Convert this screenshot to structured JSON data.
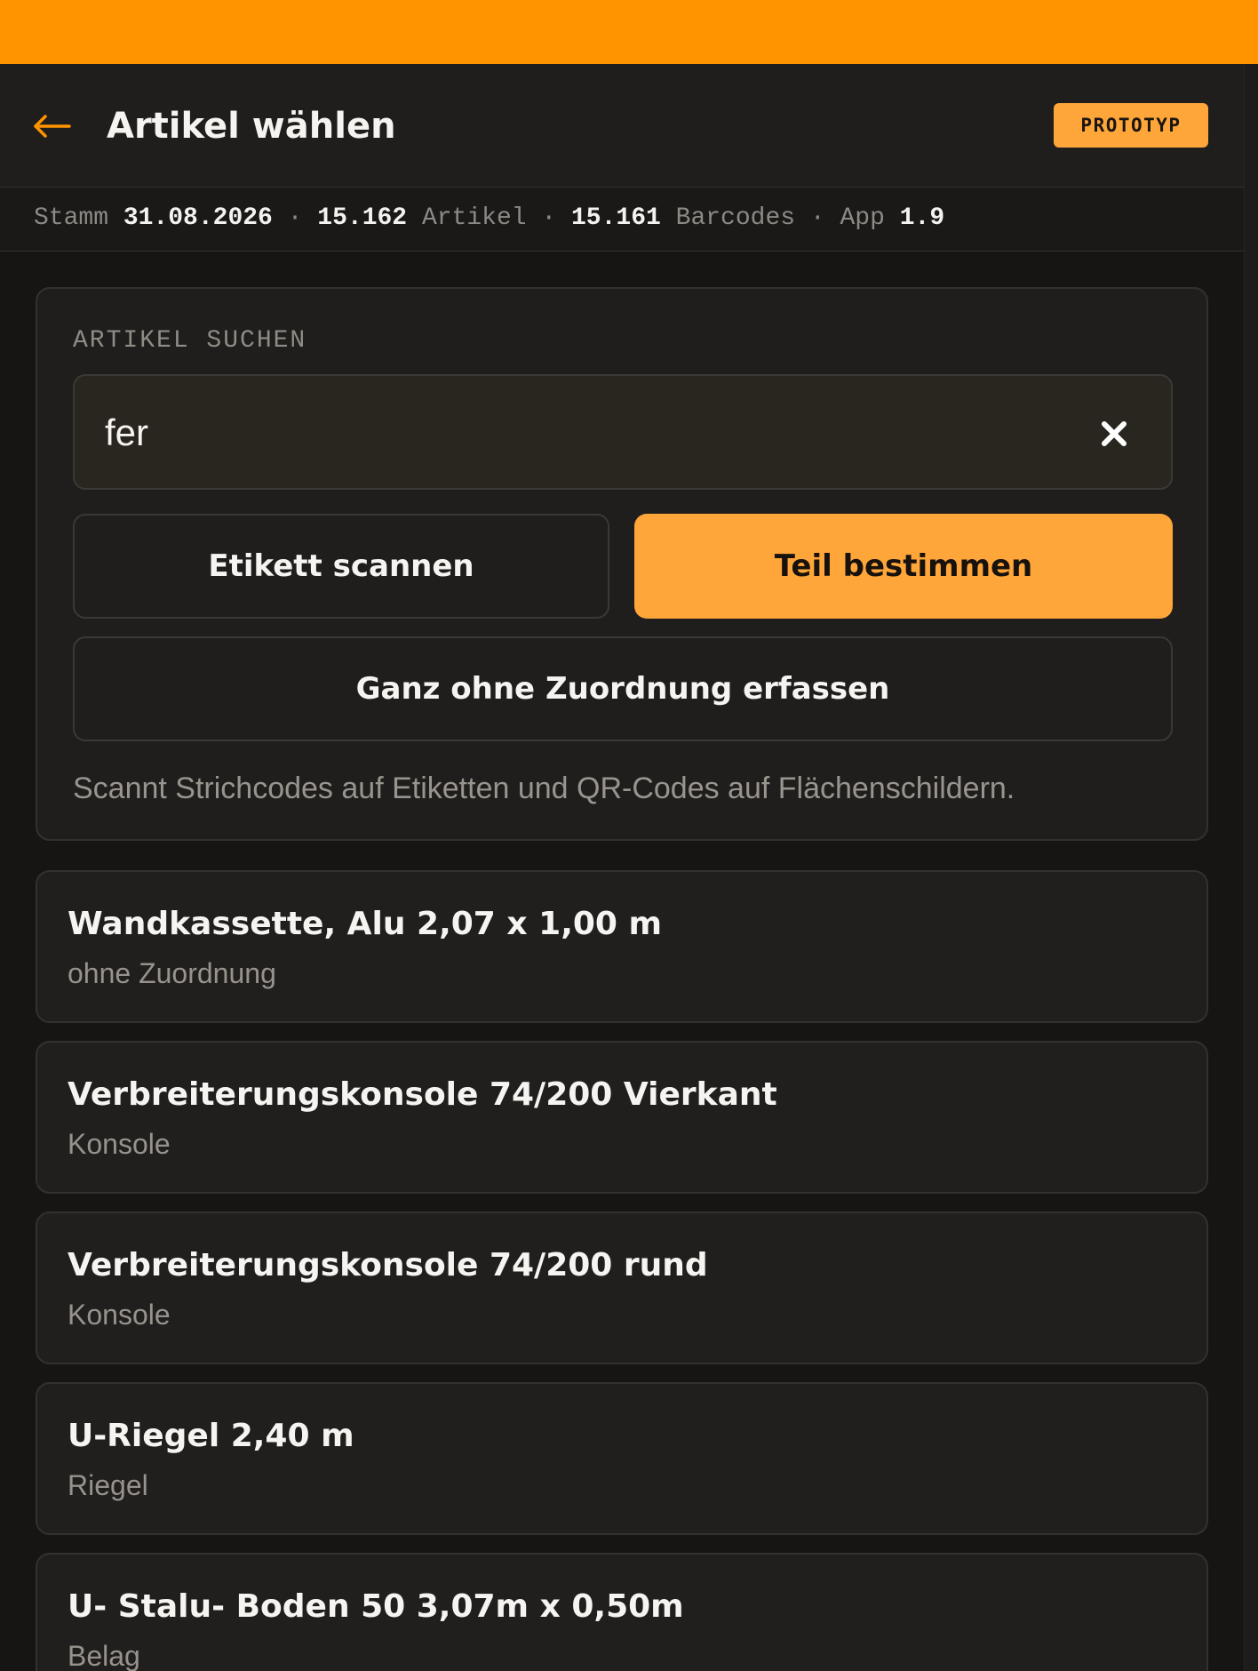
{
  "header": {
    "title": "Artikel wählen",
    "badge": "PROTOTYP"
  },
  "status": {
    "stamm_label": "Stamm",
    "stamm_date": "31.08.2026",
    "separator": "·",
    "artikel_count": "15.162",
    "artikel_label": "Artikel",
    "barcode_count": "15.161",
    "barcode_label": "Barcodes",
    "app_label": "App",
    "app_version": "1.9"
  },
  "search": {
    "label": "ARTIKEL SUCHEN",
    "value": "fer",
    "scan_button": "Etikett scannen",
    "identify_button": "Teil bestimmen",
    "no_assignment_button": "Ganz ohne Zuordnung erfassen",
    "hint": "Scannt Strichcodes auf Etiketten und QR-Codes auf Flächenschildern."
  },
  "results": [
    {
      "name": "Wandkassette, Alu 2,07 x 1,00 m",
      "category": "ohne Zuordnung"
    },
    {
      "name": "Verbreiterungskonsole 74/200 Vierkant",
      "category": "Konsole"
    },
    {
      "name": "Verbreiterungskonsole 74/200 rund",
      "category": "Konsole"
    },
    {
      "name": "U-Riegel 2,40 m",
      "category": "Riegel"
    },
    {
      "name": "U- Stalu- Boden 50 3,07m x 0,50m",
      "category": "Belag"
    }
  ],
  "colors": {
    "accent": "#ff9400",
    "primary_button": "#ffa63a",
    "background": "#161514",
    "card": "#1f1e1d"
  },
  "icons": {
    "back": "arrow-left-icon",
    "clear": "close-icon"
  }
}
